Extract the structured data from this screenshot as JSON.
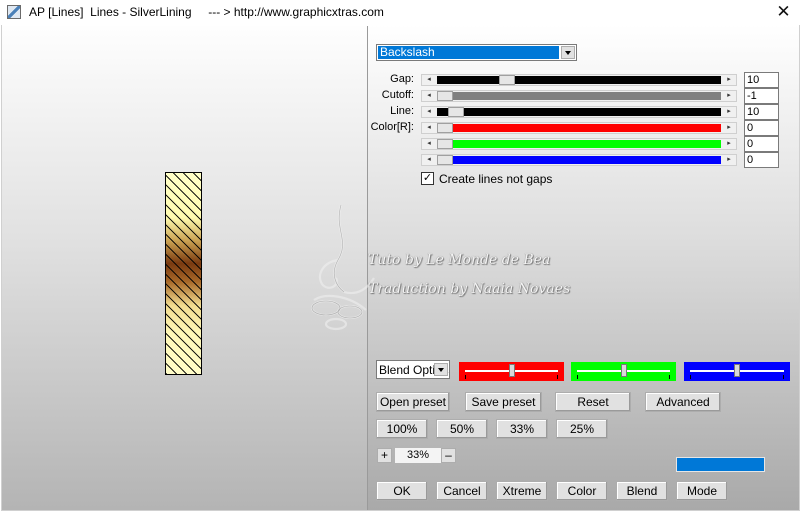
{
  "window": {
    "title": "AP [Lines]  Lines - SilverLining     --- > http://www.graphicxtras.com",
    "close_glyph": "✕"
  },
  "watermark": {
    "line1": "Tuto by Le Monde de Bea",
    "line2": "Traduction by Naaia Novaes"
  },
  "preset": {
    "value": "Backslash"
  },
  "sliders": [
    {
      "label": "Gap:",
      "value": "10",
      "level": 0.23,
      "track_color": "#000000"
    },
    {
      "label": "Cutoff:",
      "value": "-1",
      "level": 0.0,
      "track_color": "#808080"
    },
    {
      "label": "Line:",
      "value": "10",
      "level": 0.04,
      "track_color": "#000000"
    },
    {
      "label": "Color[R]:",
      "value": "0",
      "level": 0.0,
      "track_color": "#ff0000"
    },
    {
      "label": "",
      "value": "0",
      "level": 0.0,
      "track_color": "#00ff00"
    },
    {
      "label": "",
      "value": "0",
      "level": 0.0,
      "track_color": "#0000ff"
    }
  ],
  "checkbox": {
    "label": "Create lines not gaps",
    "checked": true
  },
  "blend_options": {
    "value": "Blend Options"
  },
  "color_sliders": [
    {
      "name": "red",
      "color": "#ff0000",
      "level": 0.5
    },
    {
      "name": "green",
      "color": "#00ff00",
      "level": 0.5
    },
    {
      "name": "blue",
      "color": "#0000ff",
      "level": 0.5
    }
  ],
  "buttons": {
    "open_preset": "Open preset",
    "save_preset": "Save preset",
    "reset": "Reset",
    "advanced": "Advanced",
    "zoom_100": "100%",
    "zoom_50": "50%",
    "zoom_33": "33%",
    "zoom_25": "25%",
    "ok": "OK",
    "cancel": "Cancel",
    "xtreme": "Xtreme",
    "color": "Color",
    "blend": "Blend",
    "mode": "Mode"
  },
  "zoom": {
    "plus": "+",
    "minus": "–",
    "value": "33%"
  },
  "accent_color": "#0078d7"
}
